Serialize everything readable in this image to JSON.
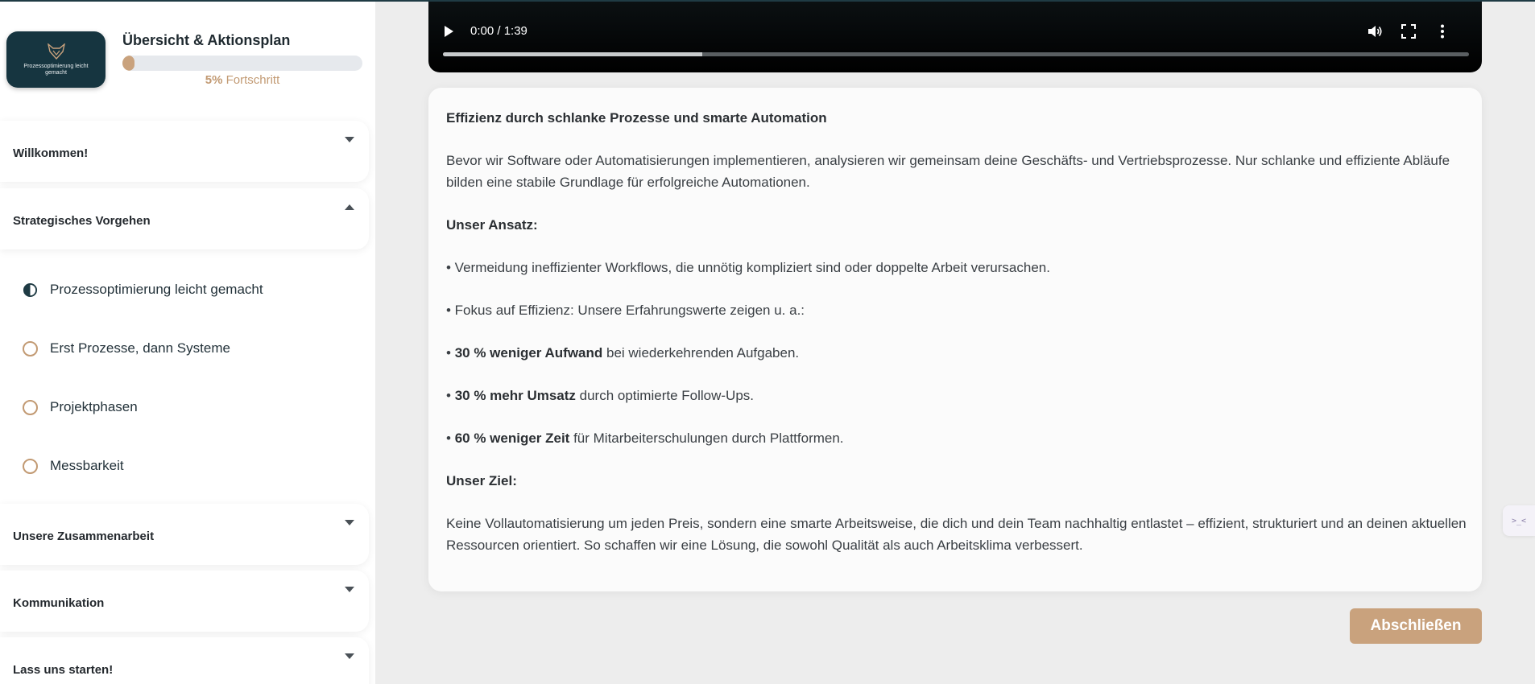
{
  "sidebar": {
    "logo_text": "Prozessoptimierung leicht gemacht",
    "title": "Übersicht & Aktionsplan",
    "progress": {
      "percent": 5,
      "percent_label": "5%",
      "suffix": " Fortschritt"
    },
    "sections": [
      {
        "title": "Willkommen!",
        "expanded": false
      },
      {
        "title": "Strategisches Vorgehen",
        "expanded": true,
        "lessons": [
          {
            "label": "Prozessoptimierung leicht gemacht",
            "status": "in-progress"
          },
          {
            "label": "Erst Prozesse, dann Systeme",
            "status": "open"
          },
          {
            "label": "Projektphasen",
            "status": "open"
          },
          {
            "label": "Messbarkeit",
            "status": "open"
          }
        ]
      },
      {
        "title": "Unsere Zusammenarbeit",
        "expanded": false
      },
      {
        "title": "Kommunikation",
        "expanded": false
      },
      {
        "title": "Lass uns starten!",
        "expanded": false
      }
    ]
  },
  "video": {
    "time": "0:00 / 1:39",
    "buffered_fraction": 0.253
  },
  "content": {
    "title": "Effizienz durch schlanke Prozesse und smarte Automation",
    "intro": "Bevor wir Software oder Automatisierungen implementieren, analysieren wir gemeinsam deine Geschäfts- und Vertriebsprozesse. Nur schlanke und effiziente Abläufe bilden eine stabile Grundlage für erfolgreiche Automationen.",
    "approach_heading": "Unser Ansatz:",
    "bullet1": "• Vermeidung ineffizienter Workflows, die unnötig kompliziert sind oder doppelte Arbeit verursachen.",
    "bullet2": "• Fokus auf Effizienz: Unsere Erfahrungswerte zeigen u. a.:",
    "stats": [
      {
        "bold": "30 % weniger Aufwand",
        "rest": " bei wiederkehrenden Aufgaben."
      },
      {
        "bold": "30 % mehr Umsatz",
        "rest": " durch optimierte Follow-Ups."
      },
      {
        "bold": "60 % weniger Zeit",
        "rest": " für Mitarbeiterschulungen durch Plattformen."
      }
    ],
    "bullet_prefix": "• ",
    "goal_heading": "Unser Ziel:",
    "goal_text": "Keine Vollautomatisierung um jeden Preis, sondern eine smarte Arbeitsweise, die dich und dein Team nachhaltig entlastet – effizient, strukturiert und an deinen aktuellen Ressourcen orientiert. So schaffen wir eine Lösung, die sowohl Qualität als auch Arbeitsklima verbessert."
  },
  "actions": {
    "complete_label": "Abschließen"
  },
  "widget": {
    "label": ">_<"
  },
  "colors": {
    "accent": "#c9a27d",
    "brand_dark": "#163540"
  }
}
